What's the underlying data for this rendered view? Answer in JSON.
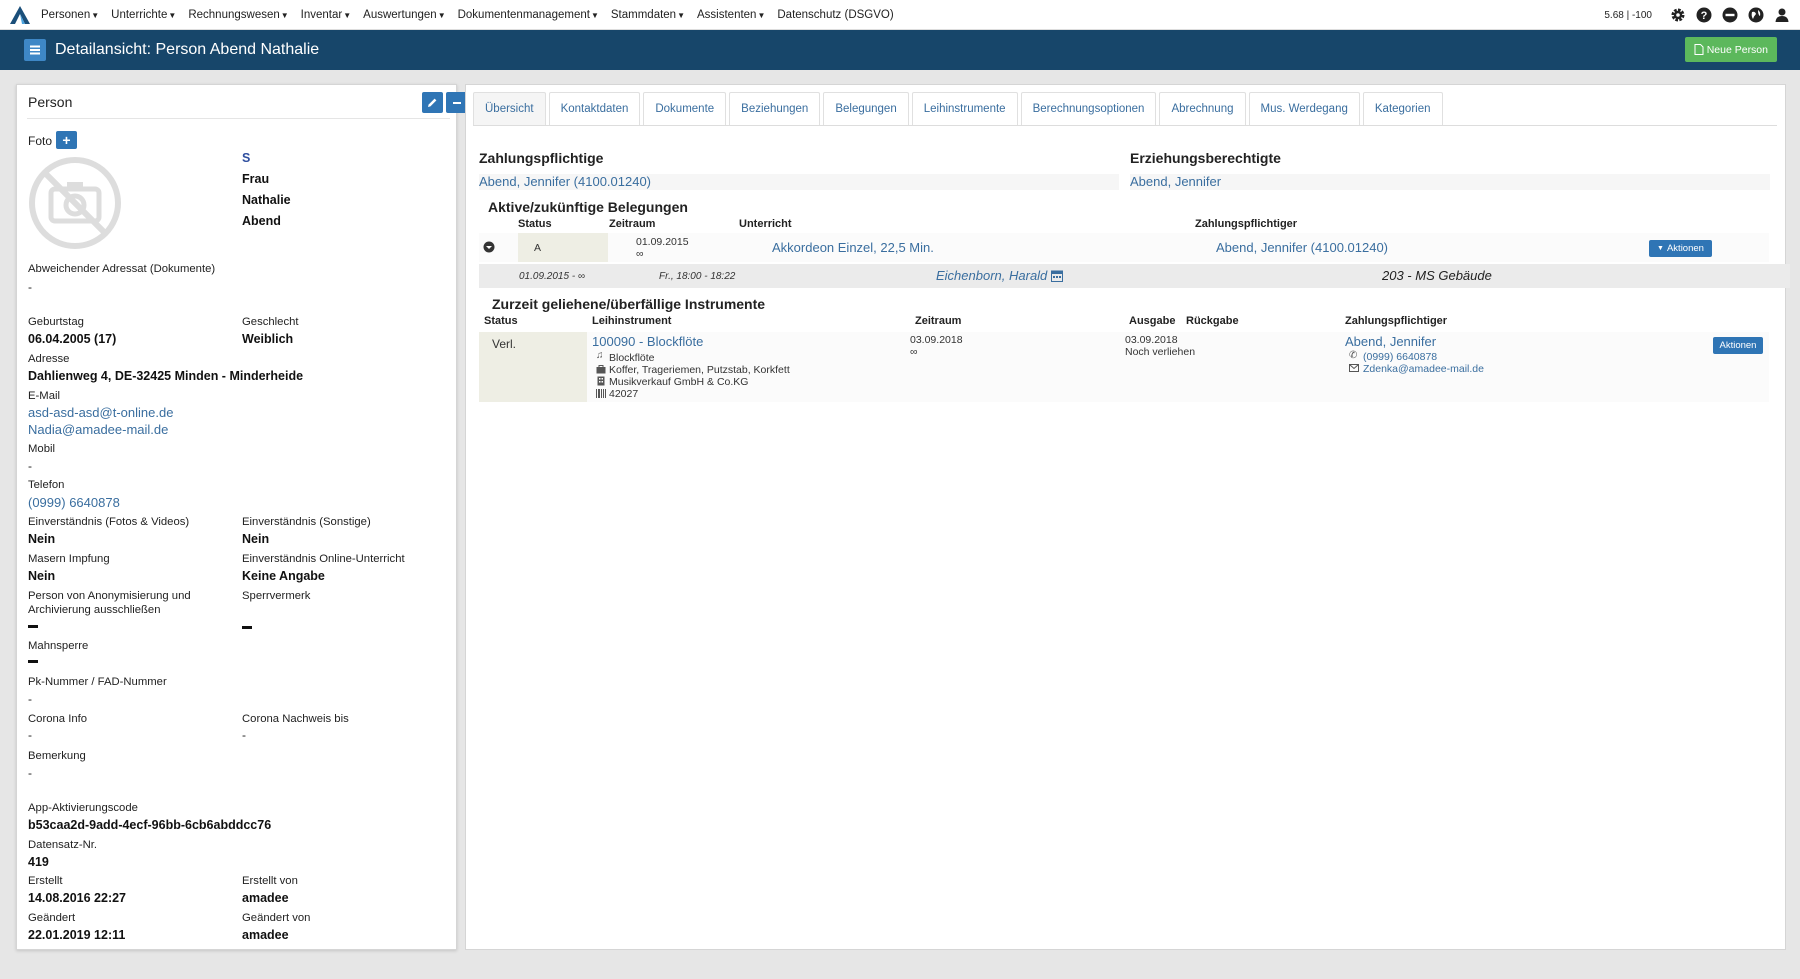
{
  "menu": {
    "items": [
      "Personen",
      "Unterrichte",
      "Rechnungswesen",
      "Inventar",
      "Auswertungen",
      "Dokumentenmanagement",
      "Stammdaten",
      "Assistenten",
      "Datenschutz (DSGVO)"
    ],
    "version": "5.68 | -100"
  },
  "header": {
    "title": "Detailansicht: Person Abend Nathalie",
    "new_button": "Neue Person"
  },
  "person": {
    "panel_title": "Person",
    "foto_label": "Foto",
    "salutation_s": "S",
    "anrede": "Frau",
    "vorname": "Nathalie",
    "nachname": "Abend",
    "abw_adressat_label": "Abweichender Adressat (Dokumente)",
    "abw_adressat_value": "-",
    "geburtstag_label": "Geburtstag",
    "geburtstag_value": "06.04.2005 (17)",
    "geschlecht_label": "Geschlecht",
    "geschlecht_value": "Weiblich",
    "adresse_label": "Adresse",
    "adresse_value": "Dahlienweg 4, DE-32425 Minden - Minderheide",
    "email_label": "E-Mail",
    "email_1": "asd-asd-asd@t-online.de",
    "email_2": "Nadia@amadee-mail.de",
    "mobil_label": "Mobil",
    "mobil_value": "-",
    "telefon_label": "Telefon",
    "telefon_value": "(0999) 6640878",
    "fotos_label": "Einverständnis (Fotos & Videos)",
    "fotos_value": "Nein",
    "sonstige_label": "Einverständnis (Sonstige)",
    "sonstige_value": "Nein",
    "masern_label": "Masern Impfung",
    "masern_value": "Nein",
    "online_label": "Einverständnis Online-Unterricht",
    "online_value": "Keine Angabe",
    "anon_label_1": "Person von Anonymisierung und",
    "anon_label_2": "Archivierung ausschließen",
    "sperr_label": "Sperrvermerk",
    "mahn_label": "Mahnsperre",
    "pk_label": "Pk-Nummer / FAD-Nummer",
    "pk_value": "-",
    "corona_info_label": "Corona Info",
    "corona_info_value": "-",
    "corona_nachweis_label": "Corona Nachweis bis",
    "corona_nachweis_value": "-",
    "bemerkung_label": "Bemerkung",
    "bemerkung_value": "-",
    "app_code_label": "App-Aktivierungscode",
    "app_code_value": "b53caa2d-9add-4ecf-96bb-6cb6abddcc76",
    "datensatz_label": "Datensatz-Nr.",
    "datensatz_value": "419",
    "erstellt_label": "Erstellt",
    "erstellt_value": "14.08.2016 22:27",
    "erstellt_von_label": "Erstellt von",
    "erstellt_von_value": "amadee",
    "geaendert_label": "Geändert",
    "geaendert_value": "22.01.2019 12:11",
    "geaendert_von_label": "Geändert von",
    "geaendert_von_value": "amadee"
  },
  "tabs": [
    "Übersicht",
    "Kontaktdaten",
    "Dokumente",
    "Beziehungen",
    "Belegungen",
    "Leihinstrumente",
    "Berechnungsoptionen",
    "Abrechnung",
    "Mus. Werdegang",
    "Kategorien"
  ],
  "overview": {
    "zahlungspflichtige_title": "Zahlungspflichtige",
    "zahlungspflichtige_value": "Abend, Jennifer (4100.01240)",
    "erziehung_title": "Erziehungsberechtigte",
    "erziehung_value": "Abend, Jennifer",
    "belegungen_title": "Aktive/zukünftige Belegungen",
    "bel_headers": {
      "status": "Status",
      "zeitraum": "Zeitraum",
      "unterricht": "Unterricht",
      "zahlungspflichtiger": "Zahlungspflichtiger"
    },
    "bel_row": {
      "status": "A",
      "zeitraum_from": "01.09.2015",
      "zeitraum_to": "∞",
      "unterricht": "Akkordeon Einzel, 22,5 Min.",
      "zahlungspflichtiger": "Abend, Jennifer (4100.01240)",
      "actions": "Aktionen",
      "detail_period": "01.09.2015 - ∞",
      "detail_time": "Fr., 18:00 - 18:22",
      "detail_teacher": "Eichenborn, Harald",
      "detail_room": "203 - MS Gebäude"
    },
    "instrumente_title": "Zurzeit geliehene/überfällige Instrumente",
    "inst_headers": {
      "status": "Status",
      "leihinstrument": "Leihinstrument",
      "zeitraum": "Zeitraum",
      "ausgabe": "Ausgabe",
      "rueckgabe": "Rückgabe",
      "zahlungspflichtiger": "Zahlungspflichtiger"
    },
    "inst_row": {
      "status": "Verl.",
      "instrument": "100090 - Blockflöte",
      "type": "Blockflöte",
      "zubehoer": "Koffer, Trageriemen, Putzstab, Korkfett",
      "haendler": "Musikverkauf GmbH & Co.KG",
      "barcode": "42027",
      "zeitraum_from": "03.09.2018",
      "zeitraum_to": "∞",
      "ausgabe": "03.09.2018",
      "rueckgabe_note": "Noch verliehen",
      "payer": "Abend, Jennifer",
      "phone": "(0999) 6640878",
      "email": "Zdenka@amadee-mail.de",
      "actions": "Aktionen"
    }
  }
}
